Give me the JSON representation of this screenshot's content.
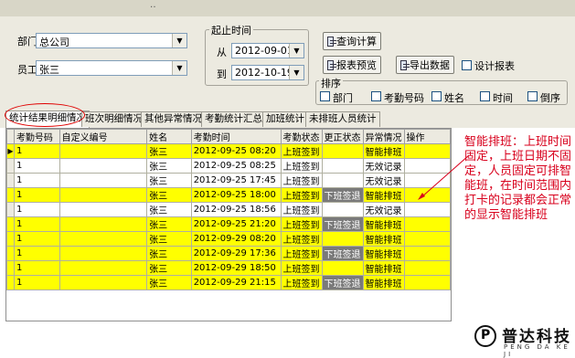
{
  "topbar": {
    "dots": "‥"
  },
  "filters": {
    "dept_label": "部门",
    "dept_value": "总公司",
    "emp_label": "员工",
    "emp_value": "张三",
    "time_group": "起止时间",
    "from_label": "从",
    "from_value": "2012-09-01",
    "to_label": "到",
    "to_value": "2012-10-19"
  },
  "buttons": {
    "query": "查询计算",
    "preview": "报表预览",
    "export": "导出数据",
    "design": "设计报表"
  },
  "sort": {
    "title": "排序",
    "options": [
      "部门",
      "考勤号码",
      "姓名",
      "时间",
      "倒序"
    ]
  },
  "tabs": [
    "统计结果明细情况",
    "班次明细情况",
    "其他异常情况",
    "考勤统计汇总",
    "加班统计",
    "未排班人员统计"
  ],
  "table": {
    "headers": [
      "考勤号码",
      "自定义编号",
      "姓名",
      "考勤时间",
      "考勤状态",
      "更正状态",
      "异常情况",
      "操作"
    ],
    "rows": [
      {
        "id": "1",
        "custom": "",
        "name": "张三",
        "time": "2012-09-25 08:20",
        "status": "上班签到",
        "fix": "",
        "abnormal": "智能排班",
        "op": "",
        "yellow": true,
        "current": true
      },
      {
        "id": "1",
        "custom": "",
        "name": "张三",
        "time": "2012-09-25 08:25",
        "status": "上班签到",
        "fix": "",
        "abnormal": "无效记录",
        "op": "",
        "yellow": false
      },
      {
        "id": "1",
        "custom": "",
        "name": "张三",
        "time": "2012-09-25 17:45",
        "status": "上班签到",
        "fix": "",
        "abnormal": "无效记录",
        "op": "",
        "yellow": false
      },
      {
        "id": "1",
        "custom": "",
        "name": "张三",
        "time": "2012-09-25 18:00",
        "status": "上班签到",
        "fix": "下班签退",
        "abnormal": "智能排班",
        "op": "",
        "yellow": true
      },
      {
        "id": "1",
        "custom": "",
        "name": "张三",
        "time": "2012-09-25 18:56",
        "status": "上班签到",
        "fix": "",
        "abnormal": "无效记录",
        "op": "",
        "yellow": false
      },
      {
        "id": "1",
        "custom": "",
        "name": "张三",
        "time": "2012-09-25 21:20",
        "status": "上班签到",
        "fix": "下班签退",
        "abnormal": "智能排班",
        "op": "",
        "yellow": true
      },
      {
        "id": "1",
        "custom": "",
        "name": "张三",
        "time": "2012-09-29 08:20",
        "status": "上班签到",
        "fix": "",
        "abnormal": "智能排班",
        "op": "",
        "yellow": true
      },
      {
        "id": "1",
        "custom": "",
        "name": "张三",
        "time": "2012-09-29 17:36",
        "status": "上班签到",
        "fix": "下班签退",
        "abnormal": "智能排班",
        "op": "",
        "yellow": true
      },
      {
        "id": "1",
        "custom": "",
        "name": "张三",
        "time": "2012-09-29 18:50",
        "status": "上班签到",
        "fix": "",
        "abnormal": "智能排班",
        "op": "",
        "yellow": true
      },
      {
        "id": "1",
        "custom": "",
        "name": "张三",
        "time": "2012-09-29 21:15",
        "status": "上班签到",
        "fix": "下班签退",
        "abnormal": "智能排班",
        "op": "",
        "yellow": true
      }
    ]
  },
  "annotation": "智能排班：上班时间固定，上班日期不固定，人员固定可排智能班，在时间范围内打卡的记录都会正常的显示智能排班",
  "logo": {
    "cn": "普达科技",
    "en": "PENG DA KE JI"
  },
  "colors": {
    "highlight": "#ffff00",
    "annotation": "#d8001c",
    "dark_cell": "#7a7a7a"
  }
}
